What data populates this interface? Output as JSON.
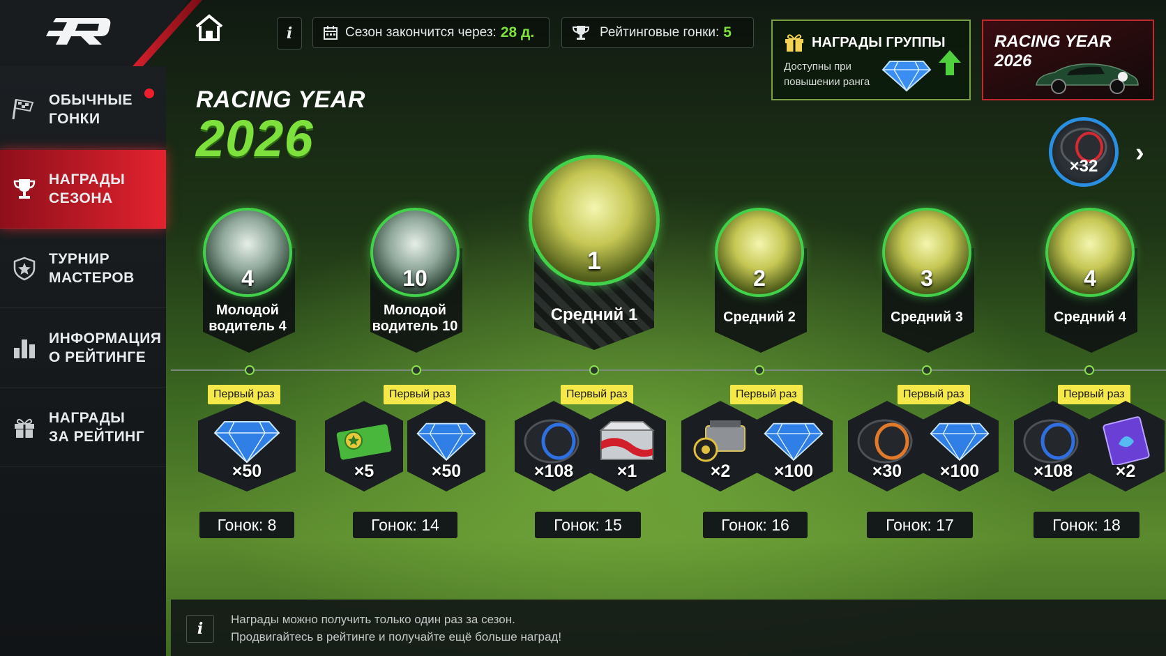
{
  "header": {
    "season_label": "Сезон закончится через:",
    "season_value": "28 д.",
    "rating_label": "Рейтинговые гонки:",
    "rating_value": "5",
    "info_glyph": "i"
  },
  "group_rewards": {
    "title": "НАГРАДЫ ГРУППЫ",
    "subtitle": "Доступны при повышении ранга"
  },
  "promo": {
    "title": "RACING YEAR 2026"
  },
  "sidebar": {
    "items": [
      {
        "label": "ОБЫЧНЫЕ ГОНКИ",
        "icon": "checkered-flag-icon",
        "active": false,
        "notification": true
      },
      {
        "label": "НАГРАДЫ СЕЗОНА",
        "icon": "trophy-icon",
        "active": true
      },
      {
        "label": "ТУРНИР МАСТЕРОВ",
        "icon": "shield-star-icon",
        "active": false
      },
      {
        "label": "ИНФОРМАЦИЯ О РЕЙТИНГЕ",
        "icon": "bar-chart-icon",
        "active": false
      },
      {
        "label": "НАГРАДЫ ЗА РЕЙТИНГ",
        "icon": "gift-icon",
        "active": false
      }
    ]
  },
  "page_title": {
    "line1": "RACING YEAR",
    "line2": "2026"
  },
  "top_reward": {
    "qty": "×32",
    "icon": "tire-icon"
  },
  "first_time_label": "Первый раз",
  "tiers": [
    {
      "rank": "4",
      "name": "Молодой водитель 4",
      "medal": "silver",
      "rewards": [
        {
          "icon": "diamond-icon",
          "qty": "×50"
        }
      ],
      "races": "Гонок: 8"
    },
    {
      "rank": "10",
      "name": "Молодой водитель 10",
      "medal": "silver",
      "rewards": [
        {
          "icon": "ticket-icon",
          "qty": "×5"
        },
        {
          "icon": "diamond-icon",
          "qty": "×50"
        }
      ],
      "races": "Гонок: 14"
    },
    {
      "rank": "1",
      "name": "Средний 1",
      "medal": "gold",
      "rewards": [
        {
          "icon": "tire-icon",
          "qty": "×108"
        },
        {
          "icon": "crate-icon",
          "qty": "×1"
        }
      ],
      "races": "Гонок: 15"
    },
    {
      "rank": "2",
      "name": "Средний 2",
      "medal": "gold",
      "rewards": [
        {
          "icon": "engine-part-icon",
          "qty": "×2"
        },
        {
          "icon": "diamond-icon",
          "qty": "×100"
        }
      ],
      "races": "Гонок: 16"
    },
    {
      "rank": "3",
      "name": "Средний 3",
      "medal": "gold",
      "rewards": [
        {
          "icon": "tire-icon",
          "qty": "×30"
        },
        {
          "icon": "diamond-icon",
          "qty": "×100"
        }
      ],
      "races": "Гонок: 17"
    },
    {
      "rank": "4",
      "name": "Средний 4",
      "medal": "gold",
      "rewards": [
        {
          "icon": "tire-icon",
          "qty": "×108"
        },
        {
          "icon": "card-icon",
          "qty": "×2"
        }
      ],
      "races": "Гонок: 18"
    }
  ],
  "footer": {
    "line1": "Награды можно получить только один раз за сезон.",
    "line2": "Продвигайтесь в рейтинге и получайте ещё больше наград!"
  }
}
